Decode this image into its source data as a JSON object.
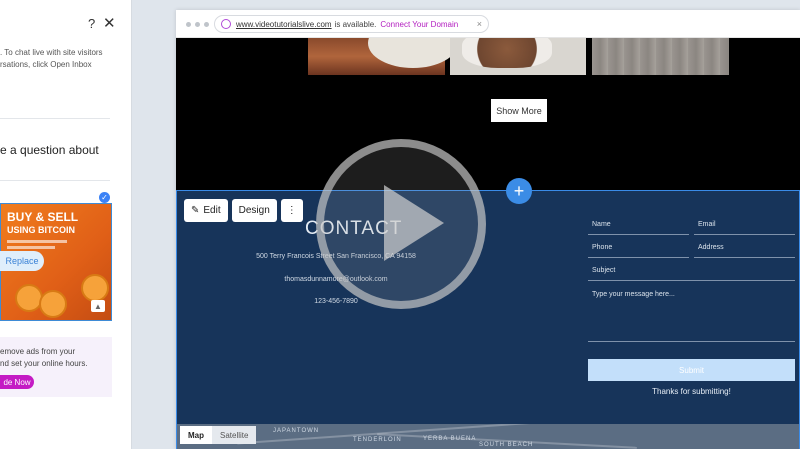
{
  "left_panel": {
    "help_icon": "?",
    "close_icon": "✕",
    "intro_line1": ". To chat live with site visitors",
    "intro_line2": "rsations, click Open Inbox",
    "question": "e a question about",
    "image_title": "BUY & SELL",
    "image_subtitle": "USING BITCOIN",
    "replace_label": "Replace",
    "promo_line1": "emove ads from your",
    "promo_line2": "nd set your online hours.",
    "upgrade_label": "de Now"
  },
  "browser": {
    "domain": "www.videotutorialslive.com",
    "available_text": "is available.",
    "connect_label": "Connect Your Domain",
    "close_label": "×"
  },
  "site": {
    "show_more": "Show More",
    "toolbar": {
      "edit": "Edit",
      "design": "Design",
      "more": "⋮"
    },
    "contact": {
      "title": "CONTACT",
      "address": "500 Terry Francois Street San Francisco, CA 94158",
      "email": "thomasdunnamore@outlook.com",
      "phone": "123-456-7890"
    },
    "form": {
      "name": "Name",
      "email": "Email",
      "phone": "Phone",
      "address": "Address",
      "subject": "Subject",
      "message": "Type your message here...",
      "submit": "Submit",
      "thanks": "Thanks for submitting!"
    },
    "map": {
      "map_label": "Map",
      "satellite_label": "Satellite",
      "labels": [
        "JAPANTOWN",
        "TENDERLOIN",
        "YERBA BUENA",
        "SOUTH BEACH"
      ]
    }
  },
  "colors": {
    "contact_bg": "#17345a",
    "accent_blue": "#3b8ce6",
    "connect_purple": "#b31ec0",
    "upgrade_pink": "#c41bc4"
  }
}
